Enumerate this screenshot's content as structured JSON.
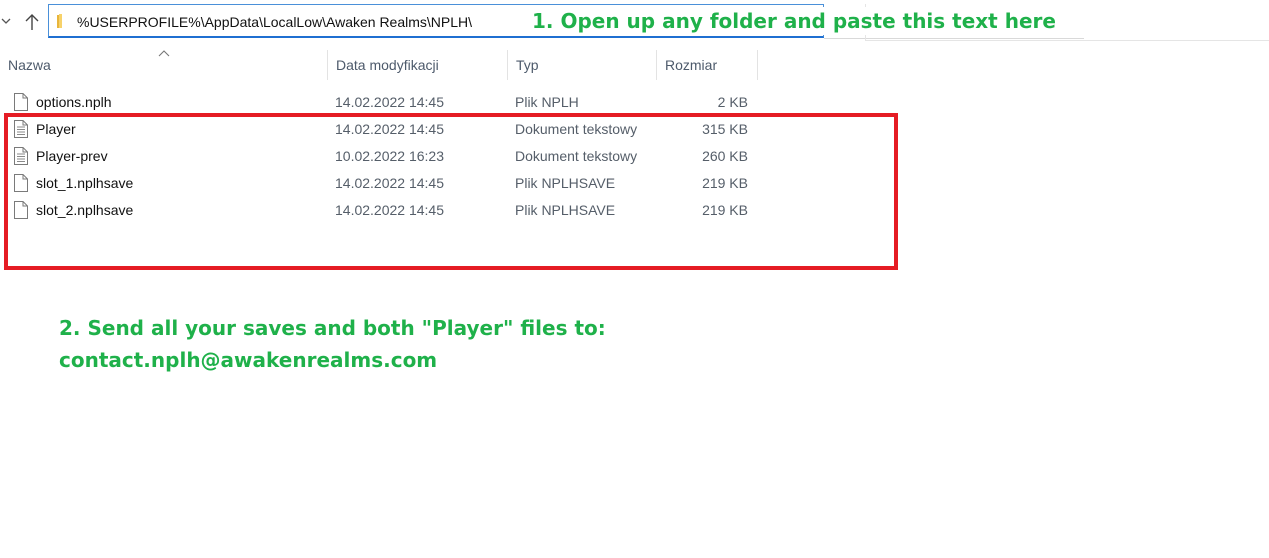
{
  "address_bar": {
    "path": "%USERPROFILE%\\AppData\\LocalLow\\Awaken Realms\\NPLH\\"
  },
  "columns": {
    "name": "Nazwa",
    "date": "Data modyfikacji",
    "type": "Typ",
    "size": "Rozmiar"
  },
  "files": [
    {
      "name": "options.nplh",
      "date": "14.02.2022 14:45",
      "type": "Plik NPLH",
      "size": "2 KB",
      "icon": "blank-file-icon"
    },
    {
      "name": "Player",
      "date": "14.02.2022 14:45",
      "type": "Dokument tekstowy",
      "size": "315 KB",
      "icon": "text-document-icon"
    },
    {
      "name": "Player-prev",
      "date": "10.02.2022 16:23",
      "type": "Dokument tekstowy",
      "size": "260 KB",
      "icon": "text-document-icon"
    },
    {
      "name": "slot_1.nplhsave",
      "date": "14.02.2022 14:45",
      "type": "Plik NPLHSAVE",
      "size": "219 KB",
      "icon": "blank-file-icon"
    },
    {
      "name": "slot_2.nplhsave",
      "date": "14.02.2022 14:45",
      "type": "Plik NPLHSAVE",
      "size": "219 KB",
      "icon": "blank-file-icon"
    }
  ],
  "annotations": {
    "step1": "1. Open up any folder and paste this text here",
    "step2_line1": "2. Send all your saves and both \"Player\" files to:",
    "step2_line2": "contact.nplh@awakenrealms.com"
  },
  "colors": {
    "annotation_green": "#1fb14a",
    "highlight_red": "#e51c24",
    "address_border": "#1f6fd1"
  }
}
